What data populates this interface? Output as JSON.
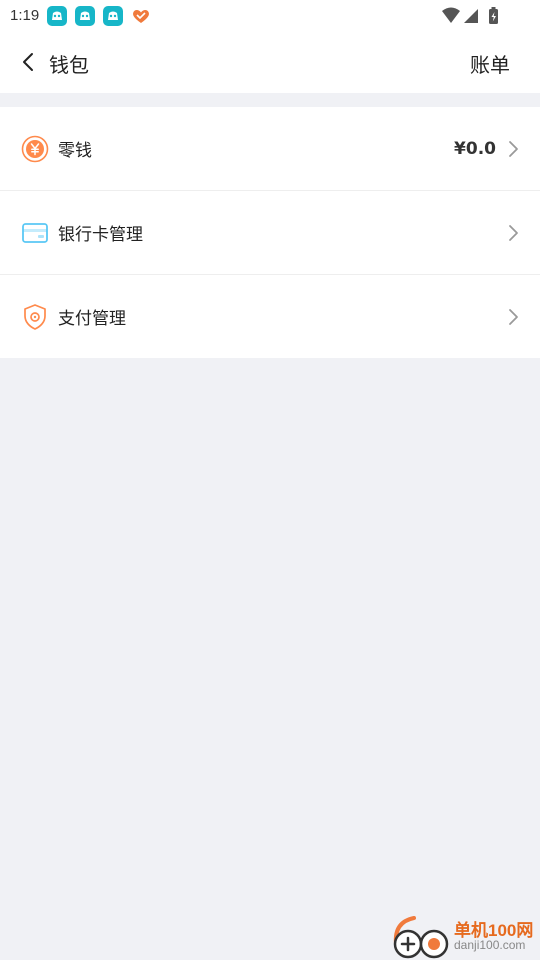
{
  "status_bar": {
    "time": "1:19",
    "notification_icons": [
      "app-notification-icon",
      "app-notification-icon",
      "app-notification-icon",
      "heart-notification-icon"
    ],
    "system_icons": [
      "wifi-icon",
      "cellular-signal-icon",
      "battery-charging-icon"
    ]
  },
  "header": {
    "back_icon": "chevron-left-icon",
    "title": "钱包",
    "bill_label": "账单"
  },
  "menu": {
    "items": [
      {
        "label": "零钱",
        "icon": "yuan-coin-icon",
        "value": "¥0.0"
      },
      {
        "label": "银行卡管理",
        "icon": "bank-card-icon",
        "value": ""
      },
      {
        "label": "支付管理",
        "icon": "shield-icon",
        "value": ""
      }
    ]
  },
  "watermark": {
    "title": "单机100网",
    "url": "danji100.com"
  },
  "colors": {
    "background": "#f0f1f5",
    "surface": "#ffffff",
    "accent_orange": "#ff8a4c",
    "card_blue": "#5ac8f5",
    "app_icon_teal": "#17b6c8"
  }
}
